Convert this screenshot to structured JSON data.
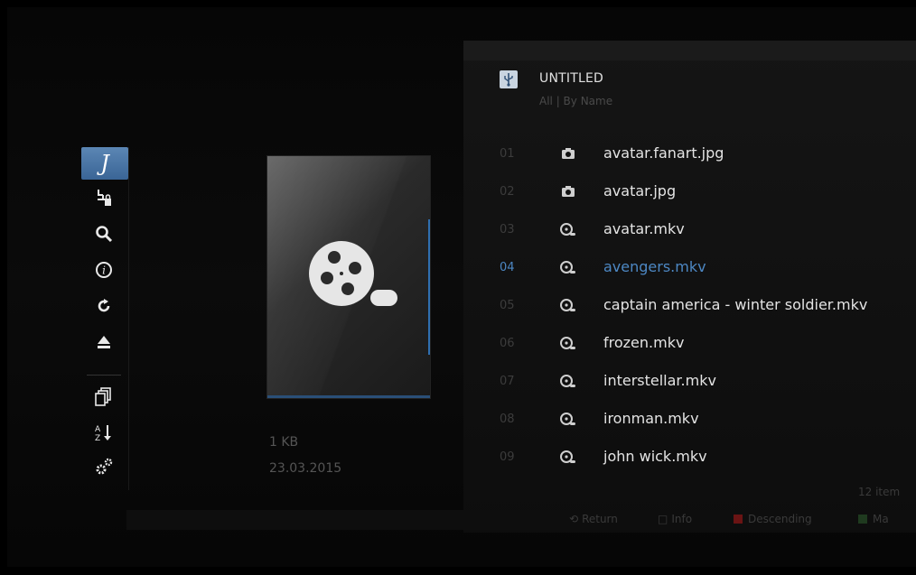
{
  "sidebar": {
    "items": [
      {
        "icon": "music-note-icon",
        "glyph": "J",
        "active": true
      },
      {
        "icon": "lock-settings-icon",
        "glyph": "⚙"
      },
      {
        "icon": "search-icon",
        "glyph": "🔍"
      },
      {
        "icon": "info-icon",
        "glyph": "ⓘ"
      },
      {
        "icon": "refresh-icon",
        "glyph": "↻"
      },
      {
        "icon": "eject-icon",
        "glyph": "⏏"
      },
      {
        "icon": "copy-icon",
        "glyph": "❐"
      },
      {
        "icon": "sort-icon",
        "glyph": "⇅"
      },
      {
        "icon": "settings-icon",
        "glyph": "⚙"
      }
    ]
  },
  "preview": {
    "size": "1 KB",
    "date": "23.03.2015"
  },
  "panel": {
    "title": "UNTITLED",
    "subtitle": "All | By Name",
    "items_count": "12 item"
  },
  "files": [
    {
      "num": "01",
      "name": "avatar.fanart.jpg",
      "type": "image",
      "glyph": "◘"
    },
    {
      "num": "02",
      "name": "avatar.jpg",
      "type": "image",
      "glyph": "◘"
    },
    {
      "num": "03",
      "name": "avatar.mkv",
      "type": "video",
      "glyph": "⚭"
    },
    {
      "num": "04",
      "name": "avengers.mkv",
      "type": "video",
      "glyph": "⚭",
      "selected": true
    },
    {
      "num": "05",
      "name": "captain america - winter soldier.mkv",
      "type": "video",
      "glyph": "⚭"
    },
    {
      "num": "06",
      "name": "frozen.mkv",
      "type": "video",
      "glyph": "⚭"
    },
    {
      "num": "07",
      "name": "interstellar.mkv",
      "type": "video",
      "glyph": "⚭"
    },
    {
      "num": "08",
      "name": "ironman.mkv",
      "type": "video",
      "glyph": "⚭"
    },
    {
      "num": "09",
      "name": "john wick.mkv",
      "type": "video",
      "glyph": "⚭"
    }
  ],
  "footer": {
    "return_label": "Return",
    "info_label": "Info",
    "descending_label": "Descending",
    "more_label": "Ma",
    "colors": {
      "red": "#6a1414",
      "green": "#1f3a1f"
    }
  },
  "colors": {
    "accent": "#4d88c4",
    "active_rail": "#4a76a6"
  }
}
